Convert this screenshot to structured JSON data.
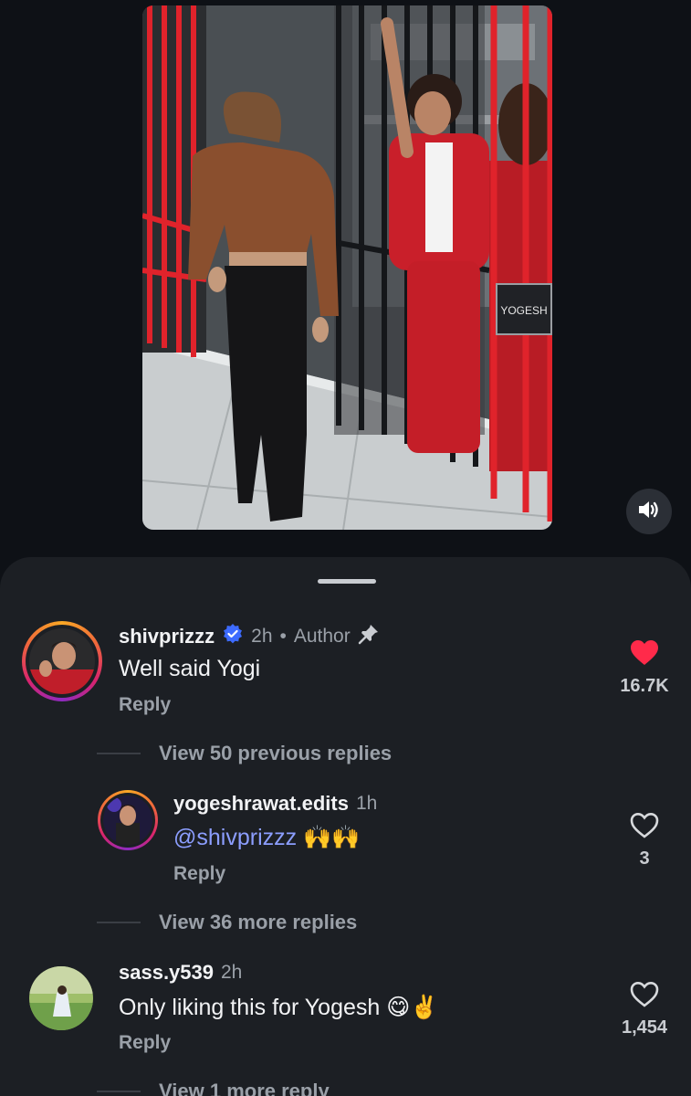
{
  "sound_button": {
    "icon": "speaker-volume-icon"
  },
  "video": {
    "sign_label": "YOGESH"
  },
  "comments": [
    {
      "username": "shivprizzz",
      "verified": true,
      "time": "2h",
      "separator": "•",
      "tag": "Author",
      "pinned": true,
      "text": "Well said Yogi",
      "reply_label": "Reply",
      "likes": "16.7K",
      "liked": true
    },
    {
      "username": "yogeshrawat.edits",
      "time": "1h",
      "mention": "@shivprizzz",
      "emoji": "🙌🙌",
      "reply_label": "Reply",
      "likes": "3",
      "liked": false
    },
    {
      "username": "sass.y539",
      "time": "2h",
      "text": "Only liking this for Yogesh",
      "emoji": "😋✌️",
      "reply_label": "Reply",
      "likes": "1,454",
      "liked": false
    }
  ],
  "thread_links": {
    "previous": "View 50 previous replies",
    "more": "View 36 more replies",
    "one_more": "View 1 more reply"
  },
  "colors": {
    "background": "#0e1116",
    "sheet": "#1c1f24",
    "heart_liked": "#ff2a4a",
    "mention": "#8c9eff",
    "verified": "#3d6bff"
  }
}
